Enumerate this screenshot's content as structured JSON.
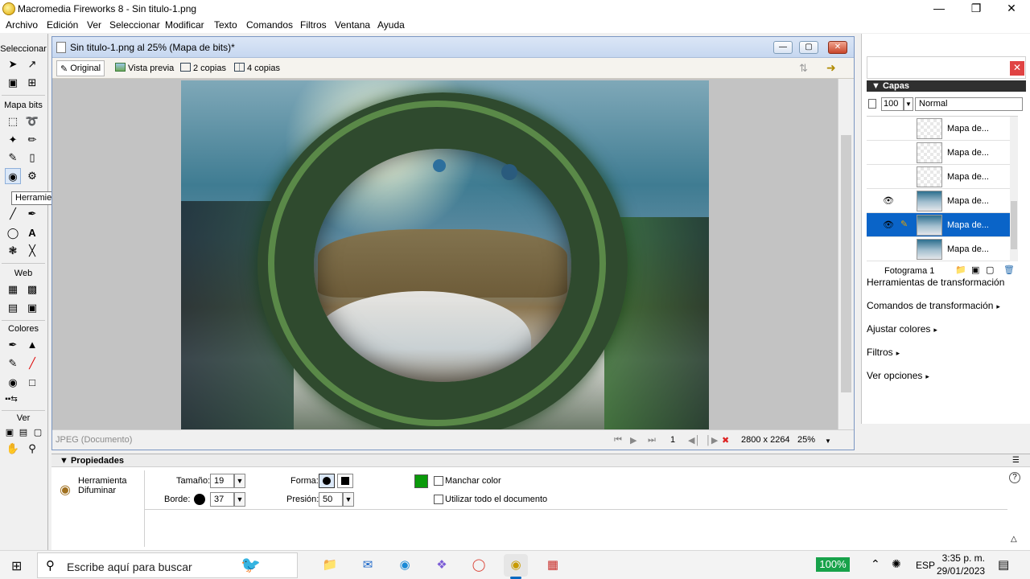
{
  "app": {
    "title": "Macromedia Fireworks 8 - Sin titulo-1.png"
  },
  "menu": [
    "Archivo",
    "Edición",
    "Ver",
    "Seleccionar",
    "Modificar",
    "Texto",
    "Comandos",
    "Filtros",
    "Ventana",
    "Ayuda"
  ],
  "tools": {
    "sections": {
      "select": "Seleccionar",
      "bitmap": "Mapa bits",
      "web": "Web",
      "colors": "Colores",
      "view": "Ver"
    },
    "tooltip": "Herramienta Difuminar (R)"
  },
  "document": {
    "title": "Sin titulo-1.png al  25% (Mapa de bits)*",
    "tabs": [
      "Original",
      "Vista previa",
      "2 copias",
      "4 copias"
    ],
    "format": "JPEG (Documento)",
    "frame": "1",
    "size": "2800 x 2264",
    "zoom": "25%"
  },
  "layers_panel": {
    "title": "Capas",
    "opacity": "100",
    "blend": "Normal",
    "layers": [
      {
        "name": "Mapa de...",
        "visible": false,
        "editing": false,
        "thumb": "transparent"
      },
      {
        "name": "Mapa de...",
        "visible": false,
        "editing": false,
        "thumb": "transparent"
      },
      {
        "name": "Mapa de...",
        "visible": false,
        "editing": false,
        "thumb": "transparent"
      },
      {
        "name": "Mapa de...",
        "visible": true,
        "editing": false,
        "thumb": "image"
      },
      {
        "name": "Mapa de...",
        "visible": true,
        "editing": true,
        "thumb": "image",
        "selected": true
      },
      {
        "name": "Mapa de...",
        "visible": false,
        "editing": false,
        "thumb": "image"
      }
    ],
    "frame_label": "Fotograma 1"
  },
  "side_panels": {
    "transform_tools": "Herramientas de transformación",
    "transform_cmds": "Comandos de transformación",
    "adjust_colors": "Ajustar colores",
    "filters": "Filtros",
    "view_options": "Ver opciones"
  },
  "properties": {
    "title": "Propiedades",
    "tool_name": "Herramienta Difuminar",
    "size_label": "Tamaño:",
    "size_value": "19",
    "edge_label": "Borde:",
    "edge_value": "37",
    "shape_label": "Forma:",
    "pressure_label": "Presión:",
    "pressure_value": "50",
    "smudge_color": "Manchar color",
    "use_entire_doc": "Utilizar todo el documento",
    "swatch_color": "#0a9a0a"
  },
  "taskbar": {
    "search_placeholder": "Escribe aquí para buscar",
    "battery": "100%",
    "lang": "ESP",
    "time": "3:35 p. m.",
    "date": "29/01/2023"
  }
}
